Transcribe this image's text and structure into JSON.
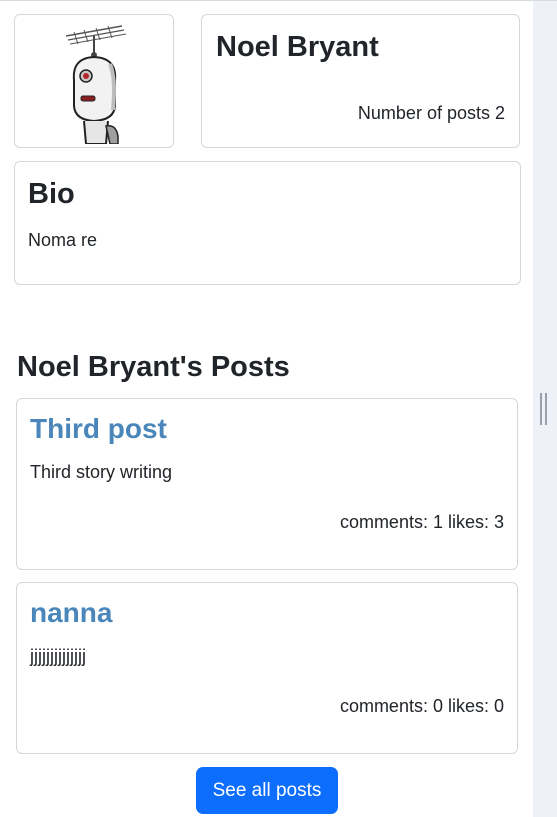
{
  "profile": {
    "avatar_icon": "robot-antenna-avatar",
    "name": "Noel Bryant",
    "posts_count_label": "Number of posts 2"
  },
  "bio": {
    "title": "Bio",
    "text": "Noma re"
  },
  "posts_section": {
    "title": "Noel Bryant's Posts",
    "posts": [
      {
        "title": "Third post",
        "body": "Third story writing",
        "stats": "comments: 1 likes: 3"
      },
      {
        "title": "nanna",
        "body": "jjjjjjjjjjjjjj",
        "stats": "comments: 0 likes: 0"
      }
    ],
    "see_all_label": "See all posts"
  },
  "colors": {
    "link": "#4a86ba",
    "primary_button": "#0d6efd",
    "border": "#d3d7dc",
    "sidebar_bg": "#eef1f7"
  }
}
